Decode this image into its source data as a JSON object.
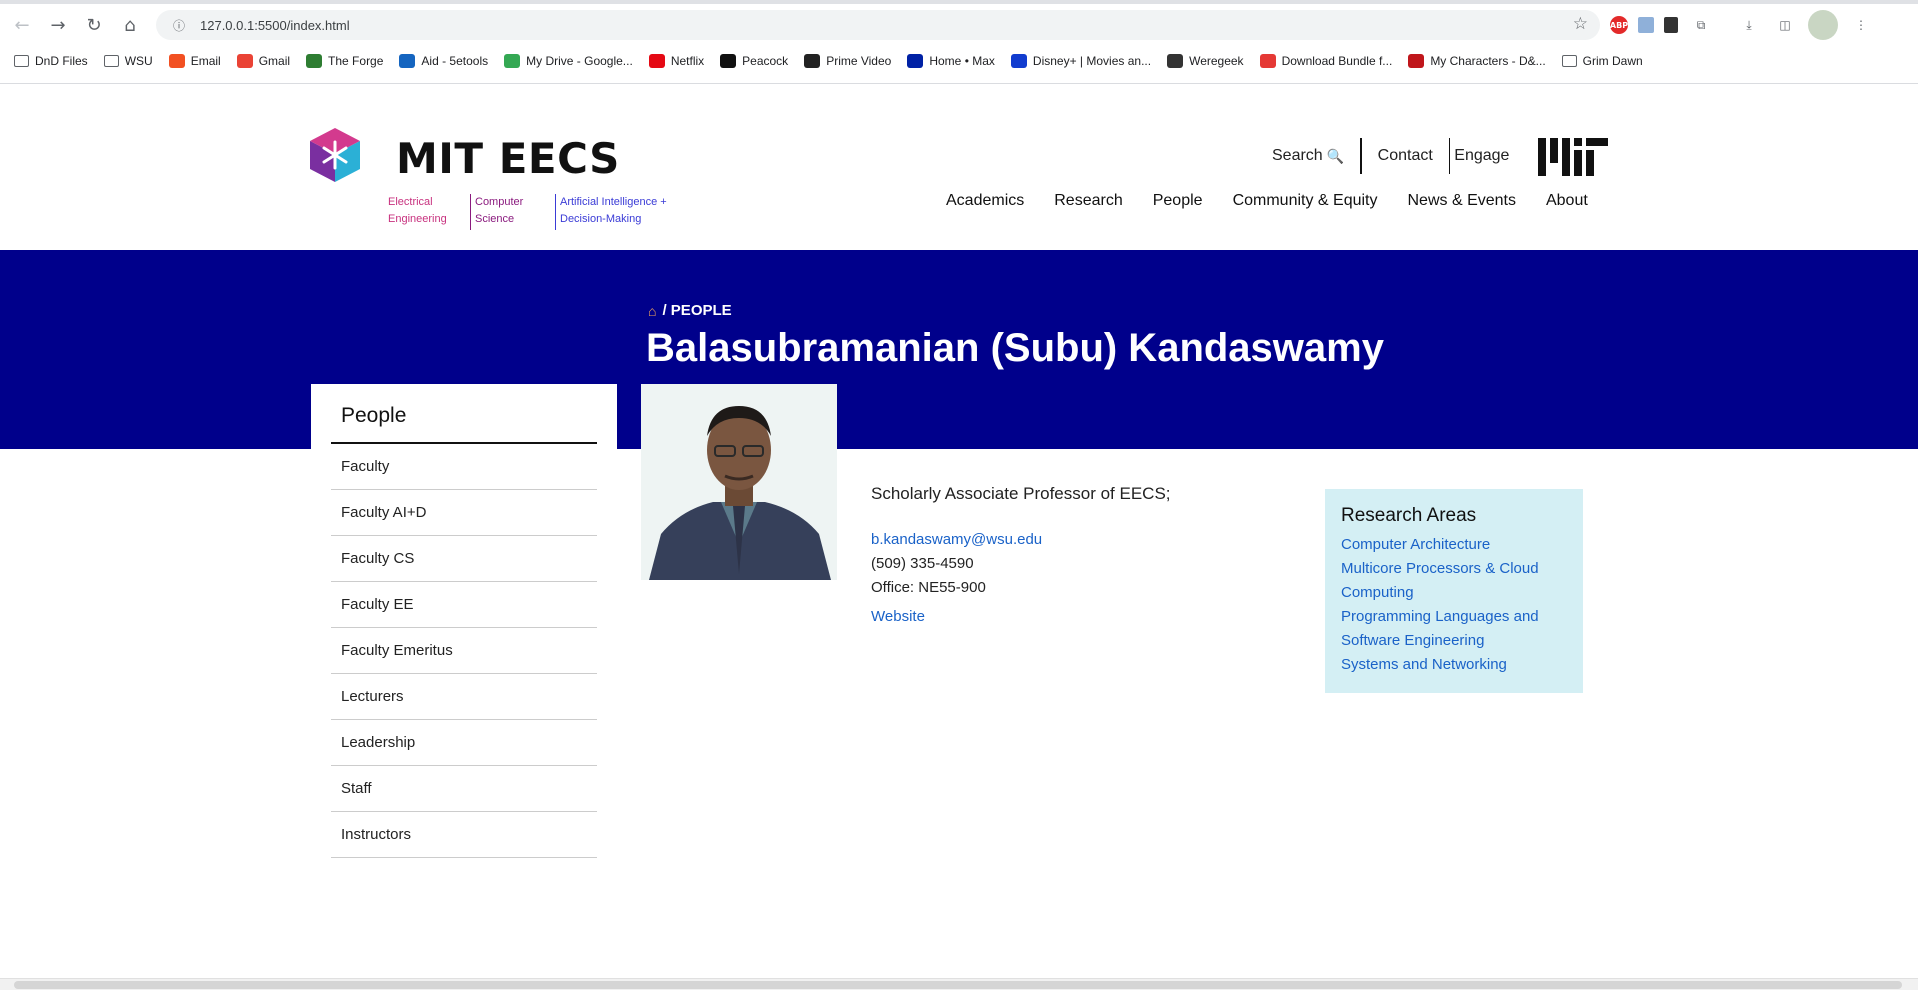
{
  "browser": {
    "url": "127.0.0.1:5500/index.html",
    "bookmarks": [
      {
        "label": "DnD Files",
        "icon": "folder-icon"
      },
      {
        "label": "WSU",
        "icon": "folder-icon"
      },
      {
        "label": "Email",
        "icon": "microsoft-icon"
      },
      {
        "label": "Gmail",
        "icon": "gmail-icon"
      },
      {
        "label": "The Forge",
        "icon": "forge-icon"
      },
      {
        "label": "Aid - 5etools",
        "icon": "5etools-icon"
      },
      {
        "label": "My Drive - Google...",
        "icon": "google-drive-icon"
      },
      {
        "label": "Netflix",
        "icon": "netflix-icon"
      },
      {
        "label": "Peacock",
        "icon": "peacock-icon"
      },
      {
        "label": "Prime Video",
        "icon": "amazon-icon"
      },
      {
        "label": "Home • Max",
        "icon": "max-icon"
      },
      {
        "label": "Disney+ | Movies an...",
        "icon": "disney-icon"
      },
      {
        "label": "Weregeek",
        "icon": "weregeek-icon"
      },
      {
        "label": "Download Bundle f...",
        "icon": "pdf-icon"
      },
      {
        "label": "My Characters - D&...",
        "icon": "dndbeyond-icon"
      },
      {
        "label": "Grim Dawn",
        "icon": "folder-icon"
      }
    ]
  },
  "header": {
    "logo_title": "MIT EECS",
    "sub_ee": "Electrical Engineering",
    "sub_cs": "Computer Science",
    "sub_ai": "Artificial Intelligence + Decision-Making",
    "util": {
      "search": "Search",
      "contact": "Contact",
      "engage": "Engage"
    },
    "nav": [
      "Academics",
      "Research",
      "People",
      "Community & Equity",
      "News & Events",
      "About"
    ]
  },
  "hero": {
    "breadcrumb": "/ PEOPLE",
    "title": "Balasubramanian (Subu) Kandaswamy"
  },
  "sidebar": {
    "title": "People",
    "items": [
      "Faculty",
      "Faculty AI+D",
      "Faculty CS",
      "Faculty EE",
      "Faculty Emeritus",
      "Lecturers",
      "Leadership",
      "Staff",
      "Instructors"
    ]
  },
  "profile": {
    "position": "Scholarly Associate Professor of EECS;",
    "email": "b.kandaswamy@wsu.edu",
    "phone": "(509) 335-4590",
    "office": "Office: NE55-900",
    "website": "Website"
  },
  "research": {
    "title": "Research Areas",
    "areas": [
      "Computer Architecture",
      "Multicore Processors & Cloud Computing",
      "Programming Languages and Software Engineering",
      "Systems and Networking"
    ]
  },
  "colors": {
    "hero_bg": "#00008b",
    "link": "#1a62c8",
    "research_bg": "#d4eff4"
  }
}
